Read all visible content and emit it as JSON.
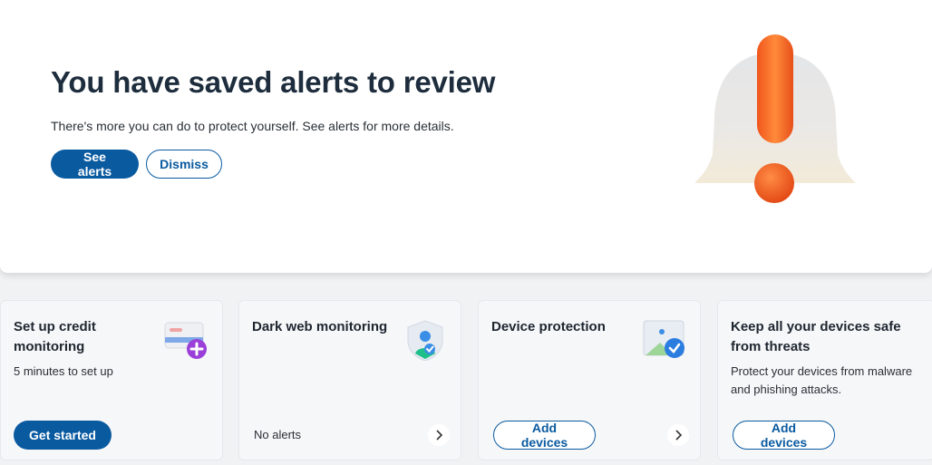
{
  "hero": {
    "title": "You have saved alerts to review",
    "subtitle": "There's more you can do to protect yourself. See alerts for more details.",
    "primary_button": "See alerts",
    "secondary_button": "Dismiss",
    "illustration": "bell-alert-icon"
  },
  "cards": [
    {
      "title": "Set up credit monitoring",
      "subtitle": "5 minutes to set up",
      "icon": "credit-card-plus-icon",
      "button": "Get started"
    },
    {
      "title": "Dark web monitoring",
      "icon": "shield-user-icon",
      "footer": "No alerts"
    },
    {
      "title": "Device protection",
      "icon": "device-check-icon",
      "button": "Add devices"
    },
    {
      "title": "Keep all your devices safe from threats",
      "subtitle": "Protect your devices from malware and phishing attacks.",
      "button": "Add devices"
    }
  ],
  "colors": {
    "accent": "#0a5aa0",
    "alert_orange": "#f26a2a",
    "background": "#f1f2f4"
  }
}
